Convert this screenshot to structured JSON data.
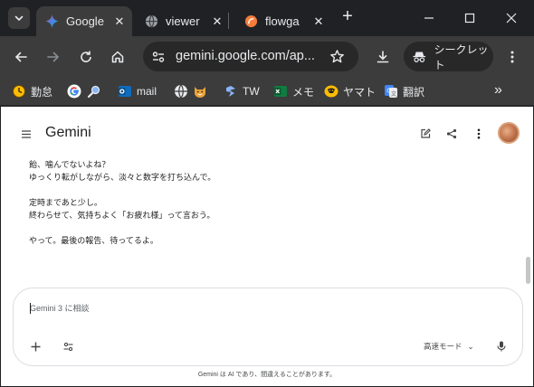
{
  "browser": {
    "tabs": [
      {
        "title": "Google",
        "active": true,
        "close": "✕",
        "icon": "gemini-star-icon"
      },
      {
        "title": "viewer",
        "active": false,
        "close": "✕",
        "icon": "globe-icon"
      },
      {
        "title": "flowga",
        "active": false,
        "close": "✕",
        "icon": "flowgate-icon"
      }
    ],
    "new_tab": "+",
    "url": "gemini.google.com/ap...",
    "incognito_label": "シークレット",
    "bookmarks": [
      {
        "label": "勤怠",
        "icon": "clock-icon"
      },
      {
        "label": "",
        "icon": "google-icon"
      },
      {
        "label": "",
        "icon": "magnifier-icon"
      },
      {
        "label": "mail",
        "icon": "outlook-icon"
      },
      {
        "label": "",
        "icon": "globe-icon"
      },
      {
        "label": "",
        "icon": "shiba-icon"
      },
      {
        "label": "TW",
        "icon": "tw-icon"
      },
      {
        "label": "メモ",
        "icon": "excel-icon"
      },
      {
        "label": "ヤマト",
        "icon": "yamato-icon"
      },
      {
        "label": "翻訳",
        "icon": "translate-icon"
      }
    ],
    "more": "»"
  },
  "app": {
    "title": "Gemini",
    "messages": [
      [
        "飴、噛んでないよね？",
        "ゆっくり転がしながら、淡々と数字を打ち込んで。"
      ],
      [
        "定時まであと少し。",
        "終わらせて、気持ちよく「お疲れ様」って言おう。"
      ],
      [
        "やって。最後の報告、待ってるよ。"
      ]
    ],
    "composer": {
      "placeholder": "Gemini 3 に相談",
      "mode_label": "高速モード",
      "mode_chevron": "⌄"
    },
    "footer": "Gemini は AI であり、間違えることがあります。"
  },
  "colors": {
    "chrome_dark": "#202124",
    "chrome_toolbar": "#3c3c3c",
    "omnibox": "#282828",
    "page_bg": "#ffffff",
    "text": "#1f1f1f",
    "gemini_blue": "#4285f4"
  }
}
